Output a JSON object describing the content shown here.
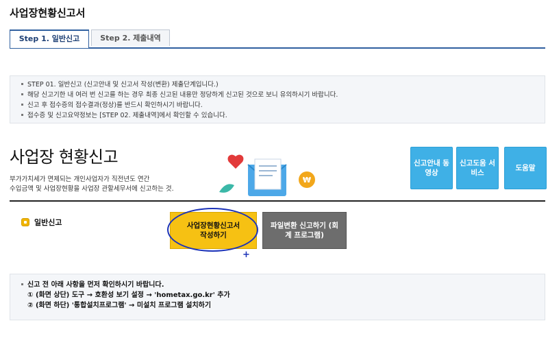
{
  "page": {
    "title": "사업장현황신고서"
  },
  "tabs": [
    {
      "label": "Step 1. 일반신고"
    },
    {
      "label": "Step 2. 제출내역"
    }
  ],
  "notice": {
    "items": [
      "STEP 01. 일반신고 (신고안내 및 신고서 작성(변환) 제출단계입니다.)",
      "해당 신고기한 내 여러 번 신고를 하는 경우 최종 신고된 내용만 정당하게 신고된 것으로 보니 유의하시기 바랍니다.",
      "신고 후 접수증의 접수결과(정상)를 반드시 확인하시기 바랍니다.",
      "접수증 및 신고요약정보는 [STEP 02. 제출내역]에서 확인할 수 있습니다."
    ]
  },
  "hero": {
    "title": "사업장 현황신고",
    "desc_line1": "부가가치세가 면제되는 개인사업자가 직전년도 연간",
    "desc_line2": "수입금액 및 사업장현황을 사업장 관할세무서에 신고하는 것."
  },
  "quick_buttons": [
    {
      "label": "신고안내 동영상"
    },
    {
      "label": "신고도움 서비스"
    },
    {
      "label": "도움말"
    }
  ],
  "general": {
    "label": "일반신고",
    "write_button": "사업장현황신고서 작성하기",
    "convert_button": "파일변환 신고하기 (회계 프로그램)"
  },
  "prebox": {
    "line1": "신고 전 아래 사항을 먼저 확인하시기 바랍니다.",
    "line2": "① (화면 상단) 도구 → 호환성 보기 설정 → 'hometax.go.kr' 추가",
    "line3": "② (화면 하단) '통합설치프로그램' → 미설치 프로그램 설치하기"
  },
  "colors": {
    "accent_blue": "#3fb0e6",
    "write_button_yellow": "#f6c113",
    "convert_button_gray": "#6d6d6d",
    "highlight_ring": "#1c33b8"
  }
}
